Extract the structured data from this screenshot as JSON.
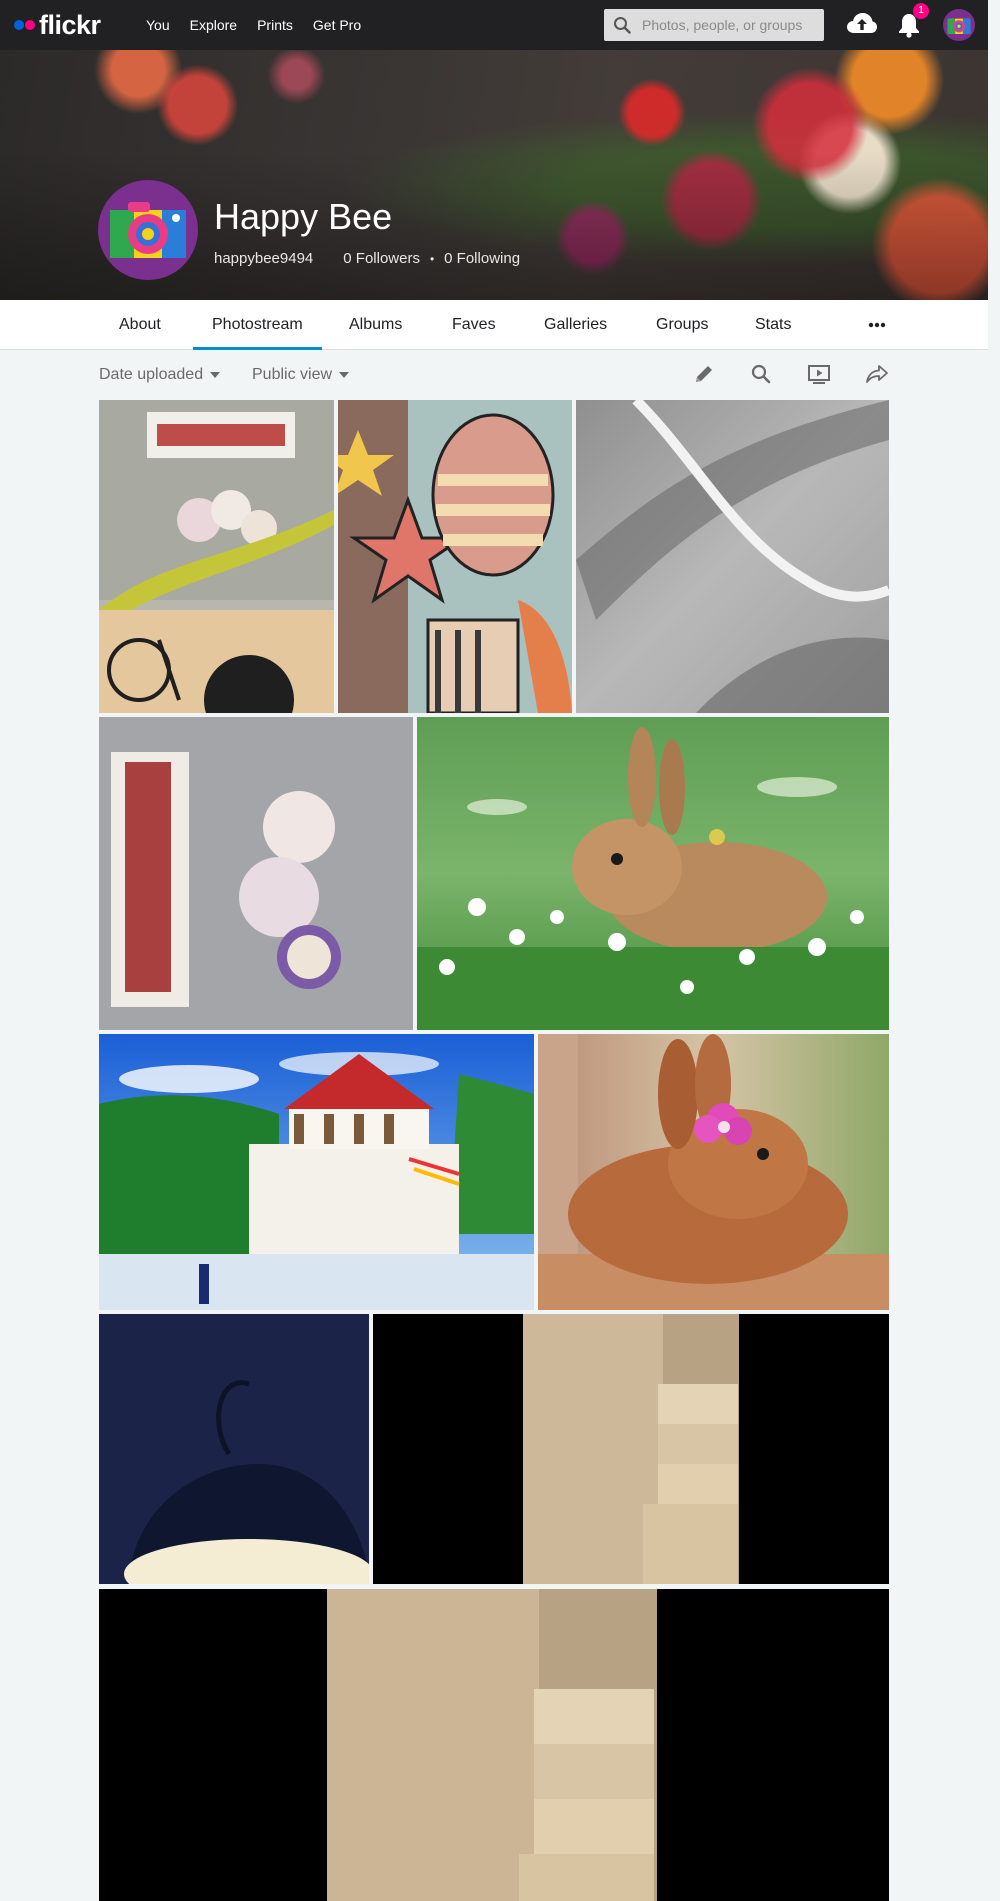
{
  "brand": {
    "name": "flickr"
  },
  "topnav": {
    "links": [
      "You",
      "Explore",
      "Prints",
      "Get Pro"
    ],
    "search_placeholder": "Photos, people, or groups",
    "notification_count": "1"
  },
  "profile": {
    "name": "Happy Bee",
    "username": "happybee9494",
    "followers": "0 Followers",
    "separator": "•",
    "following": "0 Following"
  },
  "tabs": [
    "About",
    "Photostream",
    "Albums",
    "Faves",
    "Galleries",
    "Groups",
    "Stats"
  ],
  "active_tab": "Photostream",
  "toolbar": {
    "sort_label": "Date uploaded",
    "view_label": "Public view"
  },
  "colors": {
    "nav_bg": "#212124",
    "accent": "#008ecf",
    "brand_blue": "#0063dc",
    "brand_pink": "#ff0084"
  },
  "photos": [
    "rakuten-bojio-sticker",
    "colorful-star-pattern",
    "grayscale-cable",
    "rakuten-bojio-sticker-closeup",
    "bunny-in-daisies",
    "temple-of-the-tooth",
    "bunny-with-pink-flower",
    "desk-lamp-dark",
    "wooden-shelf-narrow",
    "wooden-shelf-wide"
  ]
}
